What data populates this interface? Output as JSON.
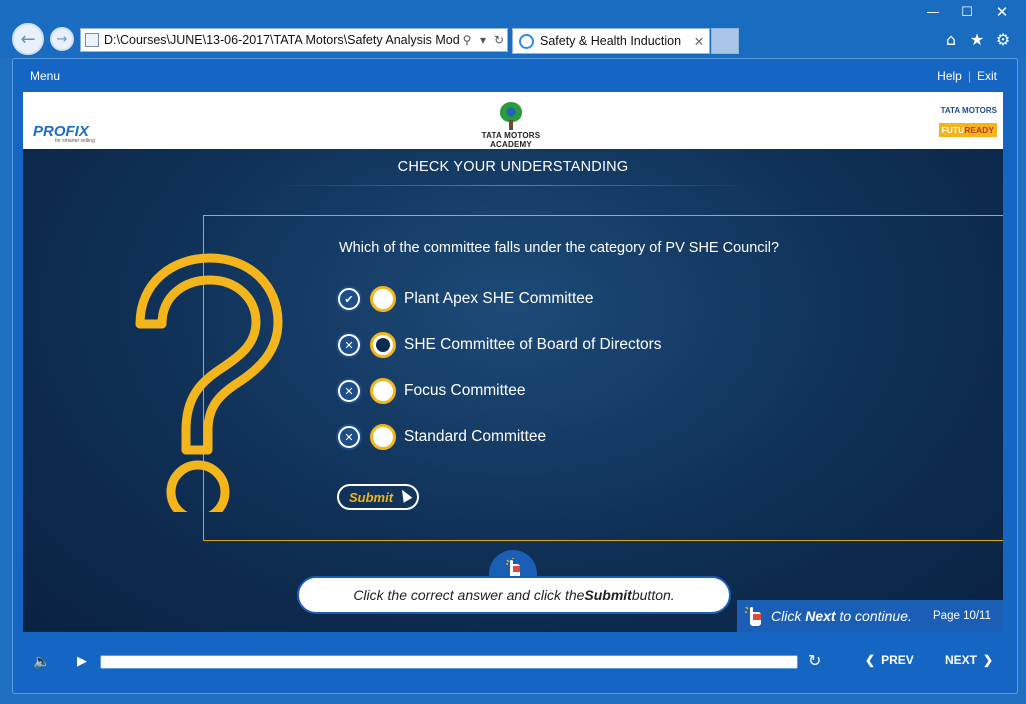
{
  "browser": {
    "address": "D:\\Courses\\JUNE\\13-06-2017\\TATA Motors\\Safety Analysis Modu",
    "tab_title": "Safety & Health Induction",
    "tab_close": "✕",
    "window_controls": [
      "—",
      "☐",
      "✕"
    ]
  },
  "player": {
    "menu_label": "Menu",
    "help_label": "Help",
    "separator": "|",
    "exit_label": "Exit"
  },
  "header": {
    "left_logo": "PROFIX",
    "left_logo_tagline": "for smarter selling",
    "center_logo": "TATA MOTORS ACADEMY",
    "right_brand": "TATA MOTORS",
    "right_badge_a": "FUTU",
    "right_badge_b": "READY"
  },
  "quiz": {
    "section_title": "CHECK YOUR UNDERSTANDING",
    "question": "Which of the committee falls under the category of PV SHE Council?",
    "options": [
      {
        "label": "Plant Apex SHE Committee",
        "feedback": "✔",
        "selected": false
      },
      {
        "label": "SHE Committee of Board of Directors",
        "feedback": "✕",
        "selected": true
      },
      {
        "label": "Focus Committee",
        "feedback": "✕",
        "selected": false
      },
      {
        "label": "Standard Committee",
        "feedback": "✕",
        "selected": false
      }
    ],
    "submit_label": "Submit"
  },
  "instruction": {
    "pre": "Click the correct answer and click the ",
    "bold": "Submit",
    "post": " button."
  },
  "next_hint": {
    "pre": "Click ",
    "bold": "Next",
    "post": " to continue.",
    "page": "Page 10/11"
  },
  "controls": {
    "prev_label": "PREV",
    "next_label": "NEXT",
    "progress": 0
  },
  "colors": {
    "accent_yellow": "#f3b51c",
    "frame_blue": "#1566c3",
    "stage_navy": "#0f2f55"
  }
}
